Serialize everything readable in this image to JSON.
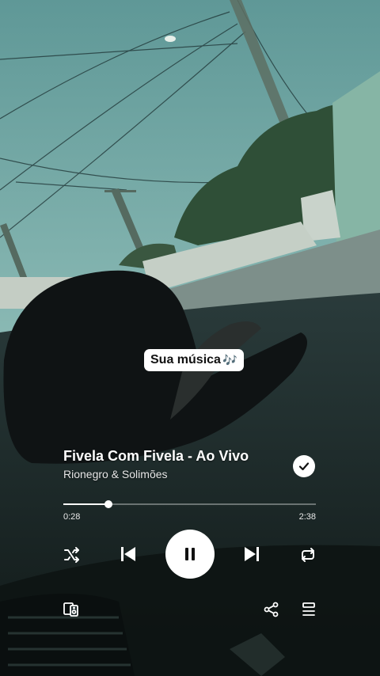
{
  "sticker": {
    "label": "Sua música",
    "note_glyph": "🎶"
  },
  "player": {
    "title": "Fivela Com Fivela - Ao Vivo",
    "artist": "Rionegro & Solimões",
    "elapsed": "0:28",
    "duration": "2:38",
    "progress_fraction": 0.18,
    "saved": true,
    "is_playing": true
  },
  "controls": [
    "shuffle-icon",
    "previous-icon",
    "pause-icon",
    "next-icon",
    "repeat-icon"
  ],
  "bottom_bar": [
    "connect-device-icon",
    "share-icon",
    "queue-icon"
  ],
  "colors": {
    "accent": "#ffffff",
    "sky": "#6fa7a6",
    "car_interior": "#15201f"
  }
}
